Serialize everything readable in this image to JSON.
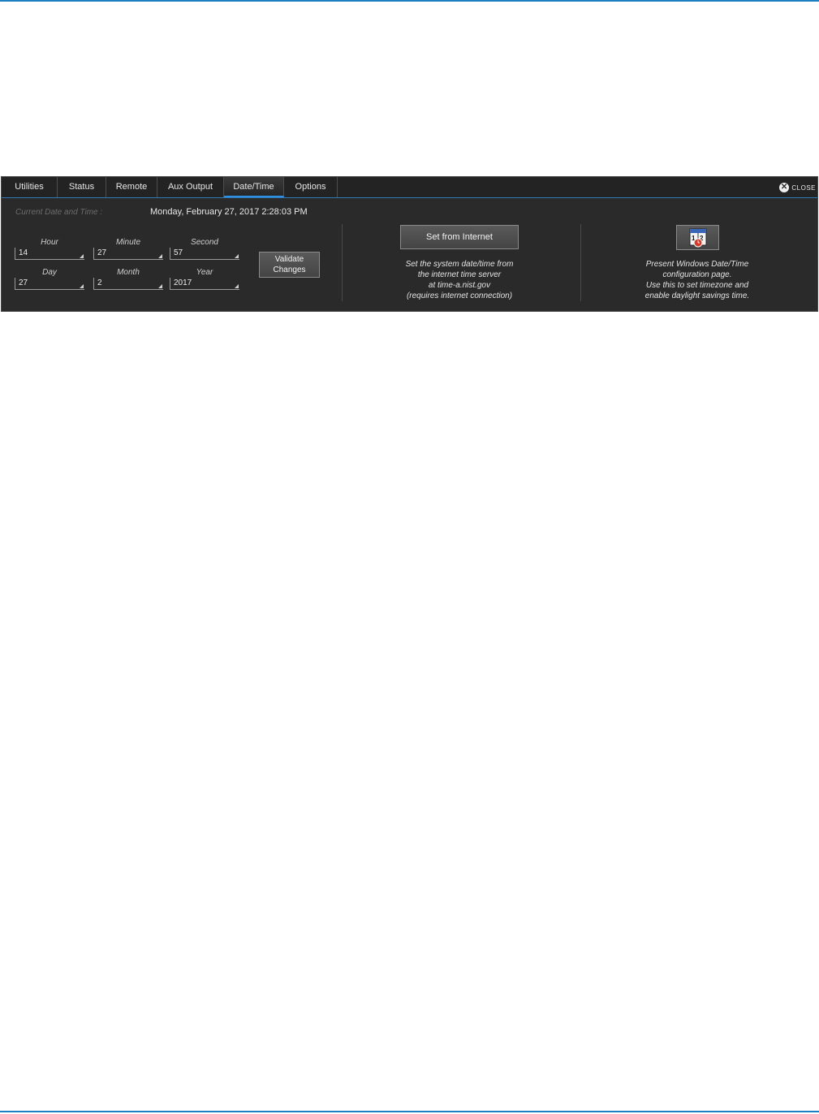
{
  "tabs": [
    "Utilities",
    "Status",
    "Remote",
    "Aux Output",
    "Date/Time",
    "Options"
  ],
  "active_tab": "Date/Time",
  "close_label": "CLOSE",
  "current": {
    "label": "Current Date and Time :",
    "value": "Monday, February 27, 2017 2:28:03 PM"
  },
  "fields": {
    "hour": {
      "label": "Hour",
      "value": "14"
    },
    "minute": {
      "label": "Minute",
      "value": "27"
    },
    "second": {
      "label": "Second",
      "value": "57"
    },
    "day": {
      "label": "Day",
      "value": "27"
    },
    "month": {
      "label": "Month",
      "value": "2"
    },
    "year": {
      "label": "Year",
      "value": "2017"
    }
  },
  "validate": {
    "line1": "Validate",
    "line2": "Changes"
  },
  "internet": {
    "button": "Set from Internet",
    "desc": [
      "Set the system date/time from",
      "the internet time server",
      "at time-a.nist.gov",
      "(requires internet connection)"
    ]
  },
  "windows": {
    "icon": "calendar-clock-icon",
    "desc": [
      "Present Windows Date/Time",
      "configuration page.",
      "Use this to set timezone and",
      "enable daylight savings time."
    ]
  },
  "colors": {
    "accent": "#2f8fe0",
    "panel_bg": "#2a2a2a",
    "rule": "#1c7fc2"
  }
}
